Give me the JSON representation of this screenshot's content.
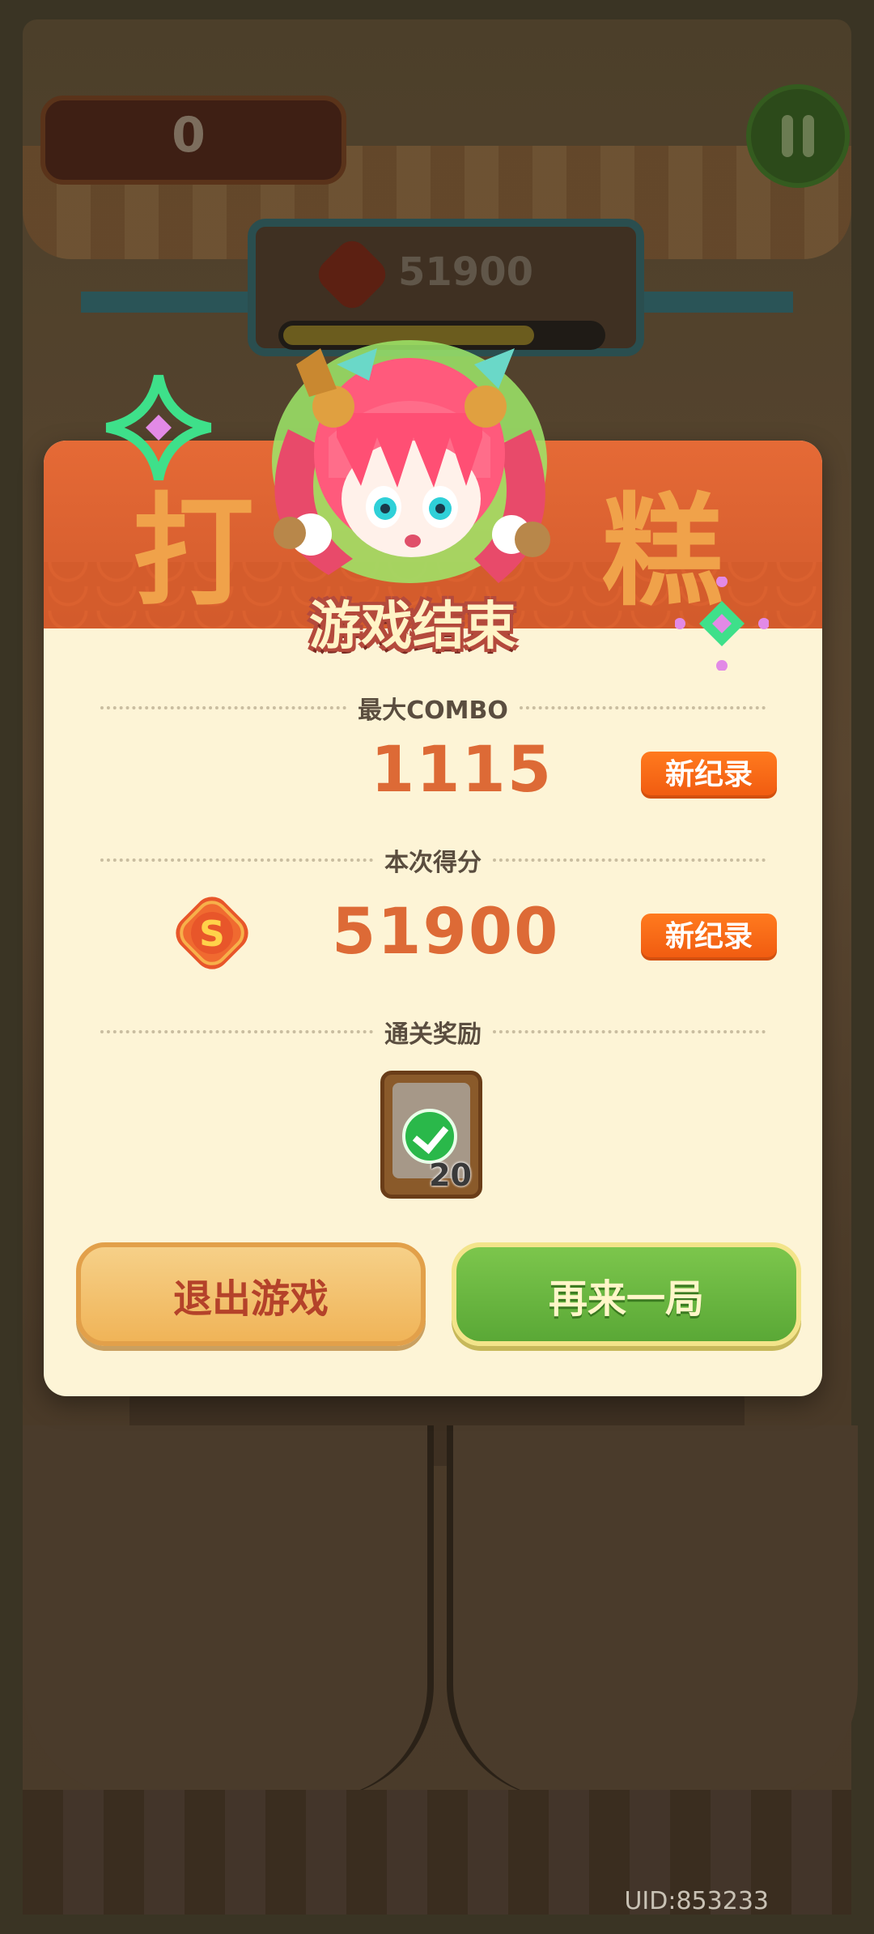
{
  "background": {
    "score": "0",
    "coins": "51900",
    "progress_fraction": 0.79,
    "header_chars": [
      "打",
      "糕"
    ]
  },
  "modal": {
    "title_part1": "游戏",
    "title_part2": "结束",
    "max_combo_label": "最大COMBO",
    "max_combo_value": "1115",
    "combo_badge": "新纪录",
    "score_label": "本次得分",
    "score_value": "51900",
    "score_badge": "新纪录",
    "reward_label": "通关奖励",
    "reward_count": "20",
    "exit_button": "退出游戏",
    "again_button": "再来一局"
  },
  "footer": {
    "uid": "UID:853233"
  },
  "colors": {
    "accent_orange": "#dd6a36",
    "badge_orange": "#f05a10",
    "green_button": "#5aa836",
    "modal_bg": "#fdf4d6"
  },
  "icons": {
    "coin": "coin-s-icon",
    "pause": "pause-icon",
    "check": "check-icon",
    "sparkle": "sparkle-icon"
  }
}
